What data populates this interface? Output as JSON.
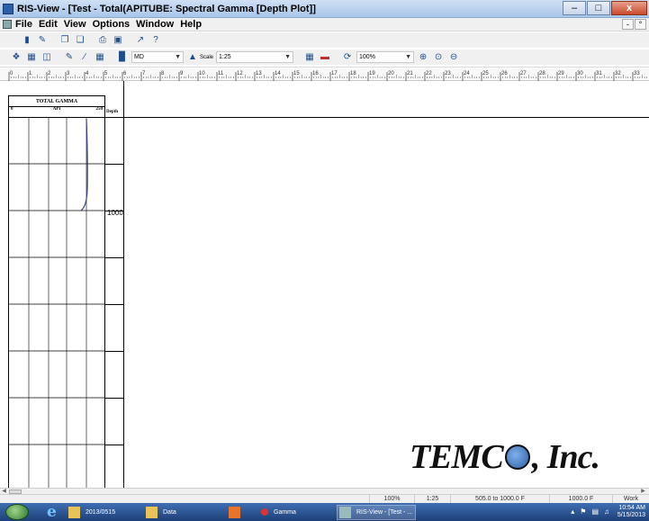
{
  "window": {
    "title": "RIS-View - [Test - Total(APITUBE: Spectral Gamma [Depth Plot]]"
  },
  "window_buttons": {
    "minimize": "–",
    "maximize": "□",
    "close": "x"
  },
  "mdi_buttons": {
    "minimize": "-",
    "restore": "°"
  },
  "menu": {
    "items": [
      "File",
      "Edit",
      "View",
      "Options",
      "Window",
      "Help"
    ]
  },
  "toolbar2": {
    "combo_md": "MD",
    "scale_label": "Scale",
    "scale_value": "1:25",
    "zoom_value": "100%"
  },
  "ruler": {
    "ticks": [
      "0",
      "1",
      "2",
      "3",
      "4",
      "5",
      "6",
      "7",
      "8",
      "9",
      "10",
      "11",
      "12",
      "13",
      "14",
      "15",
      "16",
      "17",
      "18",
      "19",
      "20",
      "21",
      "22",
      "23",
      "24",
      "25",
      "26",
      "27",
      "28",
      "29",
      "30",
      "31",
      "32",
      "33"
    ]
  },
  "track": {
    "title": "TOTAL GAMMA",
    "unit": "API",
    "min": "0",
    "max": "250",
    "curve_color": "#3a3f8f"
  },
  "depth": {
    "header": "Depth",
    "label": "1000"
  },
  "logo": {
    "text_before": "TEMC",
    "text_after": ", Inc."
  },
  "status": {
    "zoom": "100%",
    "scale": "1:25",
    "range": "505.0 to 1000.0 F",
    "depth": "1000.0 F",
    "mode": "Work"
  },
  "taskbar": {
    "tasks": [
      "2013/0515",
      "Data",
      "",
      "Gamma",
      "RIS-View - [Test - ..."
    ],
    "time": "10:54 AM",
    "date": "5/15/2013"
  }
}
